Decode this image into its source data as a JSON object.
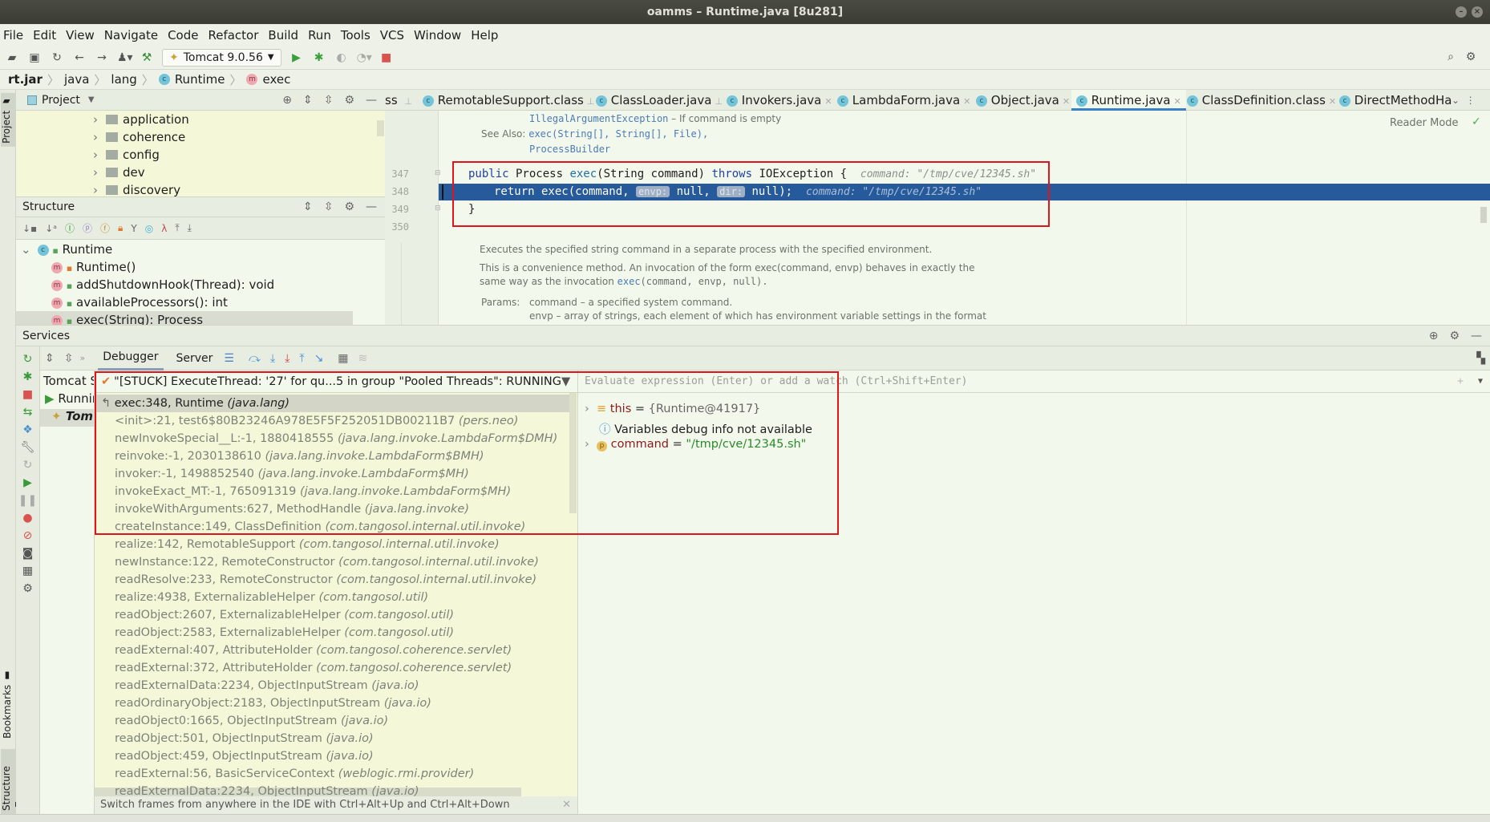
{
  "window": {
    "title": "oamms – Runtime.java [8u281]"
  },
  "menu": [
    "File",
    "Edit",
    "View",
    "Navigate",
    "Code",
    "Refactor",
    "Build",
    "Run",
    "Tools",
    "VCS",
    "Window",
    "Help"
  ],
  "toolbar": {
    "run_config": "Tomcat 9.0.56"
  },
  "breadcrumb": [
    "rt.jar",
    "java",
    "lang",
    "Runtime",
    "exec"
  ],
  "left_stripe": {
    "project": "Project",
    "bookmarks": "Bookmarks",
    "structure": "Structure"
  },
  "project_panel": {
    "title": "Project",
    "folders": [
      "application",
      "coherence",
      "config",
      "dev",
      "discovery"
    ]
  },
  "structure_panel": {
    "title": "Structure",
    "root": "Runtime",
    "members": [
      "Runtime()",
      "addShutdownHook(Thread): void",
      "availableProcessors(): int",
      "exec(String): Process"
    ]
  },
  "editor_tabs": [
    {
      "label": "ss",
      "pinned": true
    },
    {
      "label": "RemotableSupport.class",
      "pinned": true
    },
    {
      "label": "ClassLoader.java",
      "pinned": true
    },
    {
      "label": "Invokers.java"
    },
    {
      "label": "LambdaForm.java"
    },
    {
      "label": "Object.java"
    },
    {
      "label": "Runtime.java",
      "active": true
    },
    {
      "label": "ClassDefinition.class"
    },
    {
      "label": "DirectMethodHa"
    }
  ],
  "editor": {
    "reader_mode": "Reader Mode",
    "doc_top": {
      "throws_name": "IllegalArgumentException",
      "throws_desc": " – If command is empty",
      "see_also_label": "See Also:",
      "see_also_1": "exec(String[], String[], File),",
      "see_also_2": "ProcessBuilder"
    },
    "lines": [
      {
        "num": "347",
        "kw1": "public",
        "t1": " Process ",
        "m": "exec",
        "t2": "(String command) ",
        "kw2": "throws",
        "t3": " IOException {",
        "hint": "command: \"/tmp/cve/12345.sh\""
      },
      {
        "num": "348",
        "t1": "return exec(command, ",
        "inlay1": "envp:",
        "t2": " null, ",
        "inlay2": "dir:",
        "t3": " null);",
        "hint": "command: \"/tmp/cve/12345.sh\""
      },
      {
        "num": "349",
        "t1": "}"
      },
      {
        "num": "350"
      }
    ],
    "doc_bottom": {
      "p1": "Executes the specified string command in a separate process with the specified environment.",
      "p2a": "This is a convenience method. An invocation of the form exec(command, envp) behaves in exactly the",
      "p2b_pre": "same way as the invocation ",
      "p2b_link": "exec",
      "p2b_post": "(command, envp, null).",
      "params_label": "Params:",
      "param1": "command – a specified system command.",
      "param2": "envp – array of strings, each element of which has environment variable settings in the format"
    }
  },
  "services": {
    "title": "Services",
    "tabs": [
      "Debugger",
      "Server"
    ],
    "tree": [
      "Tomcat S",
      "Runnin",
      "Tom"
    ],
    "thread": "\"[STUCK] ExecuteThread: '27' for qu...5 in group \"Pooled Threads\": RUNNING",
    "frames": [
      {
        "m": "exec:348, Runtime ",
        "p": "(java.lang)",
        "current": true
      },
      {
        "m": "<init>:21, test6$80B23246A978E5F5F252051DB00211B7 ",
        "p": "(pers.neo)"
      },
      {
        "m": "newInvokeSpecial__L:-1, 1880418555 ",
        "p": "(java.lang.invoke.LambdaForm$DMH)"
      },
      {
        "m": "reinvoke:-1, 2030138610 ",
        "p": "(java.lang.invoke.LambdaForm$BMH)"
      },
      {
        "m": "invoker:-1, 1498852540 ",
        "p": "(java.lang.invoke.LambdaForm$MH)"
      },
      {
        "m": "invokeExact_MT:-1, 765091319 ",
        "p": "(java.lang.invoke.LambdaForm$MH)"
      },
      {
        "m": "invokeWithArguments:627, MethodHandle ",
        "p": "(java.lang.invoke)"
      },
      {
        "m": "createInstance:149, ClassDefinition ",
        "p": "(com.tangosol.internal.util.invoke)"
      },
      {
        "m": "realize:142, RemotableSupport ",
        "p": "(com.tangosol.internal.util.invoke)"
      },
      {
        "m": "newInstance:122, RemoteConstructor ",
        "p": "(com.tangosol.internal.util.invoke)"
      },
      {
        "m": "readResolve:233, RemoteConstructor ",
        "p": "(com.tangosol.internal.util.invoke)"
      },
      {
        "m": "realize:4938, ExternalizableHelper ",
        "p": "(com.tangosol.util)"
      },
      {
        "m": "readObject:2607, ExternalizableHelper ",
        "p": "(com.tangosol.util)"
      },
      {
        "m": "readObject:2583, ExternalizableHelper ",
        "p": "(com.tangosol.util)"
      },
      {
        "m": "readExternal:407, AttributeHolder ",
        "p": "(com.tangosol.coherence.servlet)"
      },
      {
        "m": "readExternal:372, AttributeHolder ",
        "p": "(com.tangosol.coherence.servlet)"
      },
      {
        "m": "readExternalData:2234, ObjectInputStream ",
        "p": "(java.io)"
      },
      {
        "m": "readOrdinaryObject:2183, ObjectInputStream ",
        "p": "(java.io)"
      },
      {
        "m": "readObject0:1665, ObjectInputStream ",
        "p": "(java.io)"
      },
      {
        "m": "readObject:501, ObjectInputStream ",
        "p": "(java.io)"
      },
      {
        "m": "readObject:459, ObjectInputStream ",
        "p": "(java.io)"
      },
      {
        "m": "readExternal:56, BasicServiceContext ",
        "p": "(weblogic.rmi.provider)"
      },
      {
        "m": "readExternalData:2234, ObjectInputStream ",
        "p": "(java.io)"
      }
    ],
    "tip": "Switch frames from anywhere in the IDE with Ctrl+Alt+Up and Ctrl+Alt+Down",
    "evaluate_placeholder": "Evaluate expression (Enter) or add a watch (Ctrl+Shift+Enter)",
    "variables": [
      {
        "name": "this",
        "eq": " = ",
        "value": "{Runtime@41917}"
      },
      {
        "info": "Variables debug info not available"
      },
      {
        "name": "command",
        "eq": " = ",
        "value": "\"/tmp/cve/12345.sh\""
      }
    ]
  },
  "colors": {
    "highlight_box": "#e0141c",
    "selected_line": "#265a9b",
    "tree_bg": "#f4f8d8",
    "active_tab": "#3b7fc4"
  }
}
